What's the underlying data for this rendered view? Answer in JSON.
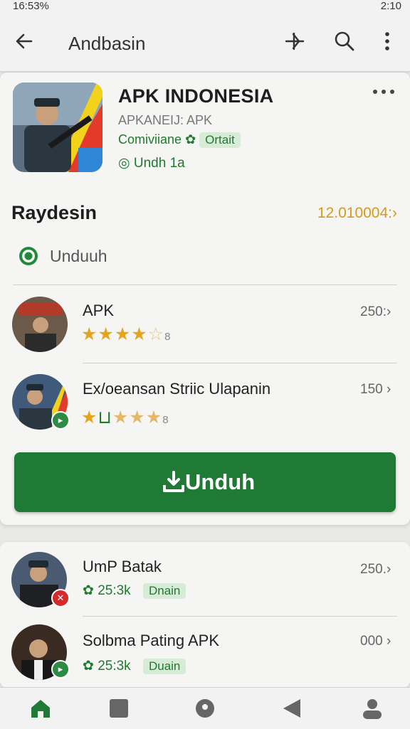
{
  "status_bar": {
    "left": "16:53%",
    "right": "2:10"
  },
  "app_bar": {
    "title": "Andbasin"
  },
  "app_header": {
    "name": "APK INDONESIA",
    "subtitle": "APKANEIJ: APK",
    "developer": "Comiviiane",
    "badge": "Ortait",
    "downloads": "Undh 1a"
  },
  "section": {
    "title": "Raydesin",
    "value": "12.010004:"
  },
  "whatsapp_row": {
    "label": "Unduuh"
  },
  "list1": [
    {
      "name": "APK",
      "number": "250:",
      "rating": 4,
      "rating_suffix": "8"
    },
    {
      "name": "Ex/oeansan Striic Ulapanin",
      "number": "150",
      "rating": 2,
      "rating_suffix": "8"
    }
  ],
  "download_button": {
    "label": "Unduh"
  },
  "list2": [
    {
      "name": "UmP Batak",
      "number": "250.",
      "count": "25:3k",
      "tag": "Dnain"
    },
    {
      "name": "Solbma Pating APK",
      "number": "000",
      "count": "25:3k",
      "tag": "Duain"
    }
  ],
  "colors": {
    "accent_green": "#1e7a34",
    "star_gold": "#e5a41b",
    "value_orange": "#d49a1e"
  },
  "icons": {
    "app_bar": [
      "arrow-left-icon",
      "share-icon",
      "search-icon",
      "more-vert-icon"
    ],
    "bottom_nav": [
      "home-icon",
      "square-icon",
      "location-icon",
      "back-triangle-icon",
      "person-icon"
    ]
  }
}
